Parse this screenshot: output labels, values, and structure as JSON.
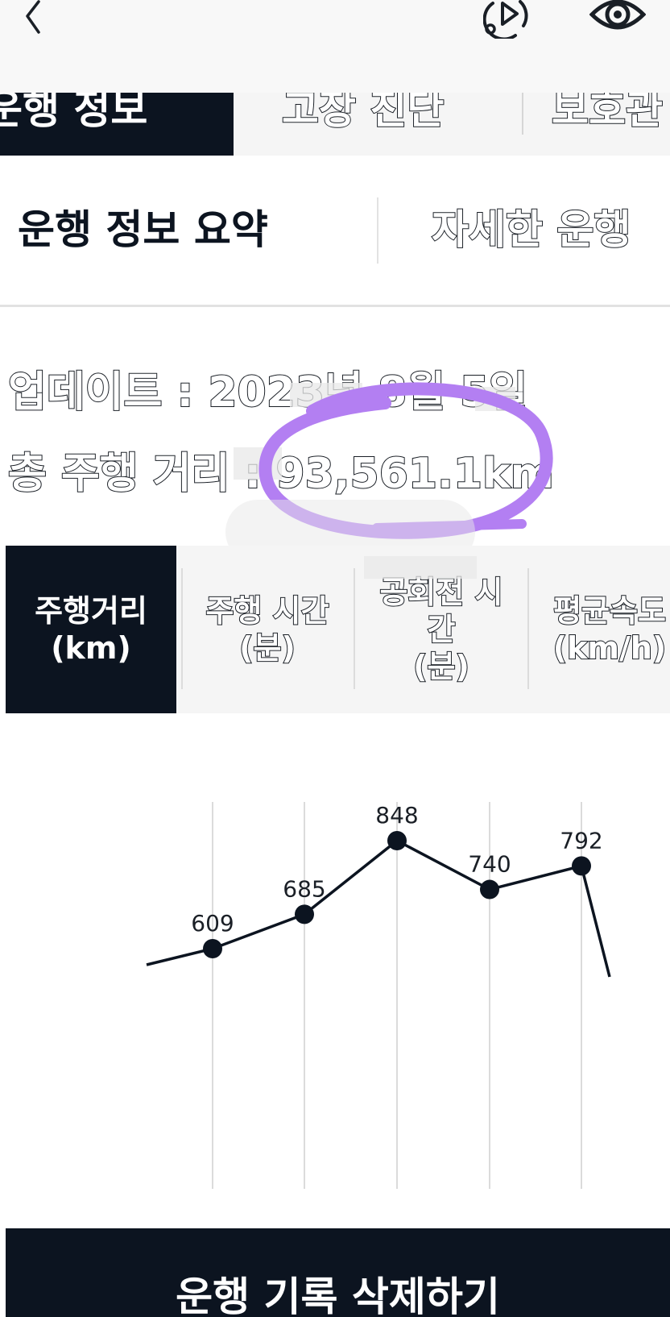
{
  "main_tabs": [
    {
      "label": "운행 정보"
    },
    {
      "label": "고장 진단"
    },
    {
      "label": "보호관"
    }
  ],
  "sub_tabs": [
    {
      "label": "운행 정보 요약"
    },
    {
      "label": "자세한 운행"
    }
  ],
  "info": {
    "update_text": "업데이트 : 2023년 8월 5일",
    "distance_text": "총 주행 거리 : 93,561.1km"
  },
  "metric_tabs": [
    {
      "line1": "주행거리",
      "line2": "(km)",
      "line3": ""
    },
    {
      "line1": "주행 시간",
      "line2": "(분)",
      "line3": ""
    },
    {
      "line1": "공회전 시",
      "line2": "간",
      "line3": "(분)"
    },
    {
      "line1": "평균속도",
      "line2": "(km/h)",
      "line3": ""
    }
  ],
  "chart_data": {
    "type": "line",
    "series": [
      {
        "values": [
          609,
          685,
          848,
          740,
          792
        ]
      }
    ],
    "data_labels": [
      "609",
      "685",
      "848",
      "740",
      "792"
    ],
    "ylim": [
      0,
      1000
    ],
    "grid": "vertical"
  },
  "bottom_button": {
    "label": "운행 기록 삭제하기"
  },
  "colors": {
    "accent_dark": "#0c1420",
    "highlight_circle": "#b37ff2",
    "tab_bg": "#f5f5f5"
  }
}
